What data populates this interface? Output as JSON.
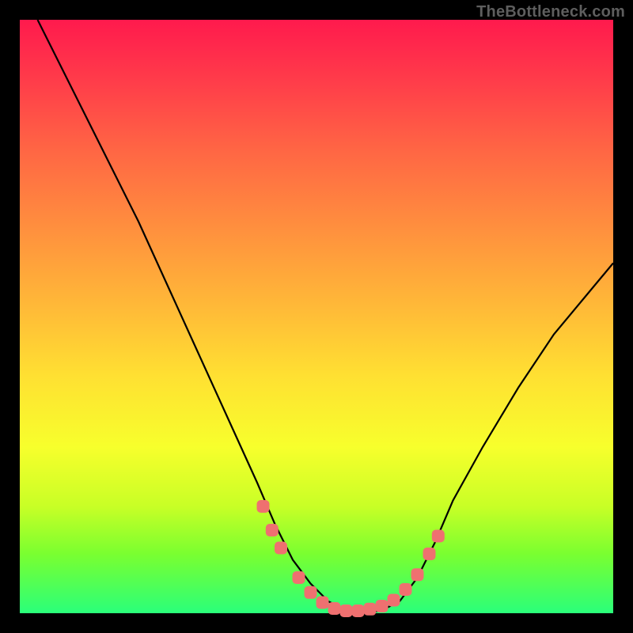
{
  "watermark": "TheBottleneck.com",
  "chart_data": {
    "type": "line",
    "title": "",
    "xlabel": "",
    "ylabel": "",
    "xlim": [
      0,
      100
    ],
    "ylim": [
      0,
      100
    ],
    "series": [
      {
        "name": "curve",
        "x": [
          3,
          6,
          10,
          15,
          20,
          25,
          30,
          35,
          40,
          43,
          46,
          49,
          52,
          55,
          58,
          61,
          64,
          67,
          70,
          73,
          78,
          84,
          90,
          95,
          100
        ],
        "y": [
          100,
          94,
          86,
          76,
          66,
          55,
          44,
          33,
          22,
          15,
          9,
          5,
          2,
          0.5,
          0,
          0.5,
          2,
          6,
          12,
          19,
          28,
          38,
          47,
          53,
          59
        ]
      }
    ],
    "markers": {
      "name": "highlight-points",
      "x": [
        41,
        42.5,
        44,
        47,
        49,
        51,
        53,
        55,
        57,
        59,
        61,
        63,
        65,
        67,
        69,
        70.5
      ],
      "y": [
        18,
        14,
        11,
        6,
        3.5,
        1.8,
        0.8,
        0.4,
        0.4,
        0.7,
        1.2,
        2.2,
        4,
        6.5,
        10,
        13
      ]
    },
    "colors": {
      "curve": "#000000",
      "marker": "#ef7070",
      "background_top": "#ff1a4d",
      "background_bottom": "#2aff7a"
    }
  }
}
